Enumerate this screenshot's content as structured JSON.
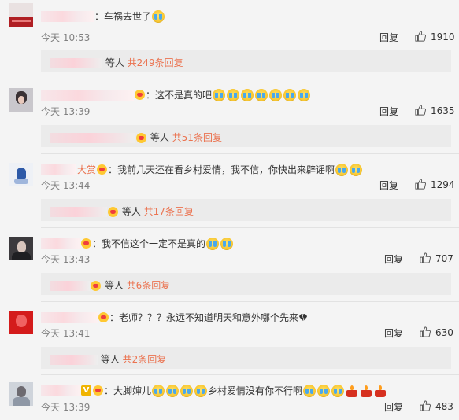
{
  "comments": [
    {
      "name": "",
      "text": "：车祸去世了",
      "time": "今天 10:53",
      "reply": "回复",
      "likes": "1910",
      "sub": {
        "pre": "等人",
        "link": "共249条回复"
      }
    },
    {
      "name": "",
      "text": "：这不是真的吧",
      "time": "今天 13:39",
      "reply": "回复",
      "likes": "1635",
      "sub": {
        "pre": "等人",
        "link": "共51条回复"
      }
    },
    {
      "name": "大赏",
      "text": "：我前几天还在看乡村爱情，我不信，你快出来辟谣啊",
      "time": "今天 13:44",
      "reply": "回复",
      "likes": "1294",
      "sub": {
        "pre": "等人",
        "link": "共17条回复"
      }
    },
    {
      "name": "",
      "text": "：我不信这个一定不是真的",
      "time": "今天 13:43",
      "reply": "回复",
      "likes": "707",
      "sub": {
        "pre": "等人",
        "link": "共6条回复"
      }
    },
    {
      "name": "",
      "text": "：老师？？？永远不知道明天和意外哪个先来",
      "time": "今天 13:41",
      "reply": "回复",
      "likes": "630",
      "sub": {
        "pre": "等人",
        "link": "共2条回复"
      }
    },
    {
      "name": "",
      "text_a": "：大脚婶儿",
      "text_b": "乡村爱情没有你不行啊",
      "time": "今天 13:39",
      "reply": "回复",
      "likes": "483"
    }
  ],
  "icons": {
    "emoji": "crying-face-icon",
    "cake": "candle-cake-icon",
    "like": "thumbs-up-icon",
    "broken_heart": "broken-heart-icon",
    "vip": "V"
  },
  "colors": {
    "link": "#eb7350",
    "background": "#f4f4f4",
    "subbox": "#ebebeb",
    "time": "#808080"
  }
}
